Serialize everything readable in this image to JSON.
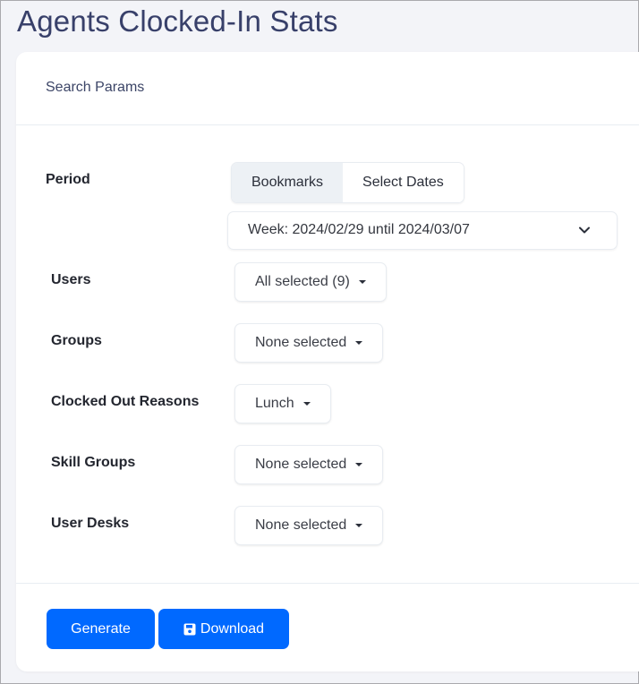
{
  "page": {
    "title": "Agents Clocked-In Stats"
  },
  "card": {
    "header_title": "Search Params"
  },
  "period": {
    "label": "Period",
    "tabs": [
      {
        "label": "Bookmarks",
        "active": true
      },
      {
        "label": "Select Dates",
        "active": false
      }
    ],
    "selected": "Week: 2024/02/29 until 2024/03/07"
  },
  "filters": [
    {
      "label": "Users",
      "value": "All selected (9)"
    },
    {
      "label": "Groups",
      "value": "None selected"
    },
    {
      "label": "Clocked Out Reasons",
      "value": "Lunch"
    },
    {
      "label": "Skill Groups",
      "value": "None selected"
    },
    {
      "label": "User Desks",
      "value": "None selected"
    }
  ],
  "actions": {
    "generate_label": "Generate",
    "download_label": "Download",
    "download_icon": "floppy-disk-icon"
  },
  "colors": {
    "primary": "#0069ff",
    "title": "#38406a"
  }
}
